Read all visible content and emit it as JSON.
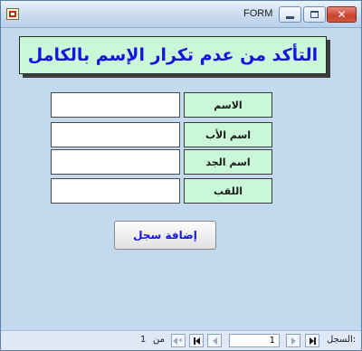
{
  "window": {
    "title": "FORM"
  },
  "banner": {
    "title": "التأكد من عدم تكرار الإسم بالكامل"
  },
  "fields": [
    {
      "label": "الاسم",
      "value": ""
    },
    {
      "label": "اسم الأب",
      "value": ""
    },
    {
      "label": "اسم الجد",
      "value": ""
    },
    {
      "label": "اللقب",
      "value": ""
    }
  ],
  "actions": {
    "add_record": "إضافة سجل"
  },
  "navigation": {
    "record_label": "السجل:",
    "current_record": "1",
    "of_label": "من",
    "total_records": "1"
  },
  "colors": {
    "form_background": "#c2d9ee",
    "banner_fill": "#c9f7d7",
    "accent_text": "#1414e0"
  },
  "icons": {
    "app": "access-form-icon",
    "minimize": "minimize-icon",
    "maximize": "maximize-icon",
    "close": "close-icon",
    "first": "first-record-icon",
    "previous": "previous-record-icon",
    "next": "next-record-icon",
    "last": "last-record-icon",
    "new": "new-record-icon"
  }
}
